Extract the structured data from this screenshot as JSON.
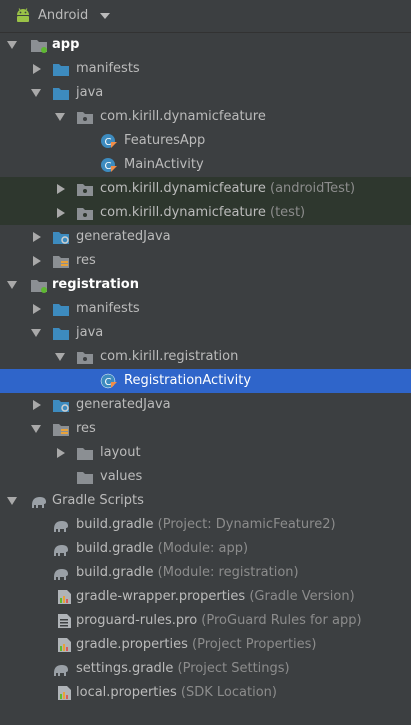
{
  "header": {
    "title": "Android"
  },
  "tree": {
    "app": "app",
    "app_manifests": "manifests",
    "app_java": "java",
    "app_pkg": "com.kirill.dynamicfeature",
    "features_app": "FeaturesApp",
    "main_activity": "MainActivity",
    "app_pkg_test1": "com.kirill.dynamicfeature",
    "app_pkg_test1_hint": "(androidTest)",
    "app_pkg_test2": "com.kirill.dynamicfeature",
    "app_pkg_test2_hint": "(test)",
    "app_generated": "generatedJava",
    "app_res": "res",
    "registration": "registration",
    "reg_manifests": "manifests",
    "reg_java": "java",
    "reg_pkg": "com.kirill.registration",
    "registration_activity": "RegistrationActivity",
    "reg_generated": "generatedJava",
    "reg_res": "res",
    "layout": "layout",
    "values": "values",
    "gradle_scripts": "Gradle Scripts",
    "g1": "build.gradle",
    "g1_hint": "(Project: DynamicFeature2)",
    "g2": "build.gradle",
    "g2_hint": "(Module: app)",
    "g3": "build.gradle",
    "g3_hint": "(Module: registration)",
    "g4": "gradle-wrapper.properties",
    "g4_hint": "(Gradle Version)",
    "g5": "proguard-rules.pro",
    "g5_hint": "(ProGuard Rules for app)",
    "g6": "gradle.properties",
    "g6_hint": "(Project Properties)",
    "g7": "settings.gradle",
    "g7_hint": "(Project Settings)",
    "g8": "local.properties",
    "g8_hint": "(SDK Location)"
  },
  "colors": {
    "background": "#3c3f41",
    "selection": "#2f65ca",
    "test_rows": "#2e372e",
    "folder_blue": "#3d8bbf",
    "gray_folder": "#9aa0a6",
    "hint": "#8c8c8c",
    "text": "#bbbbbb"
  },
  "icons": {
    "android": "android-icon",
    "module": "module-folder-icon",
    "folder": "folder-icon",
    "package": "package-icon",
    "class": "kotlin-class-icon",
    "generated": "generated-folder-icon",
    "res": "res-folder-icon",
    "gradle": "gradle-elephant-icon",
    "properties": "properties-file-icon"
  }
}
